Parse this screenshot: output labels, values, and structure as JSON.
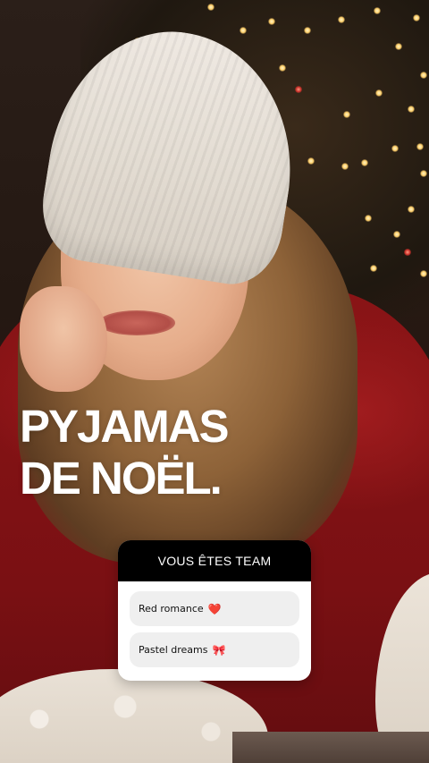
{
  "story": {
    "headline_lines": [
      "PYJAMAS",
      "DE NOËL."
    ]
  },
  "poll": {
    "question": "VOUS ÊTES TEAM",
    "options": [
      {
        "label": "Red romance",
        "emoji": "❤️",
        "icon": "red-heart-icon"
      },
      {
        "label": "Pastel dreams",
        "emoji": "🎀",
        "icon": "pink-bow-icon"
      }
    ]
  },
  "colors": {
    "poll_header": "#000000",
    "poll_body": "#ffffff",
    "option_bg": "#efefef",
    "headline": "#ffffff",
    "sweater_red": "#8a1416"
  }
}
